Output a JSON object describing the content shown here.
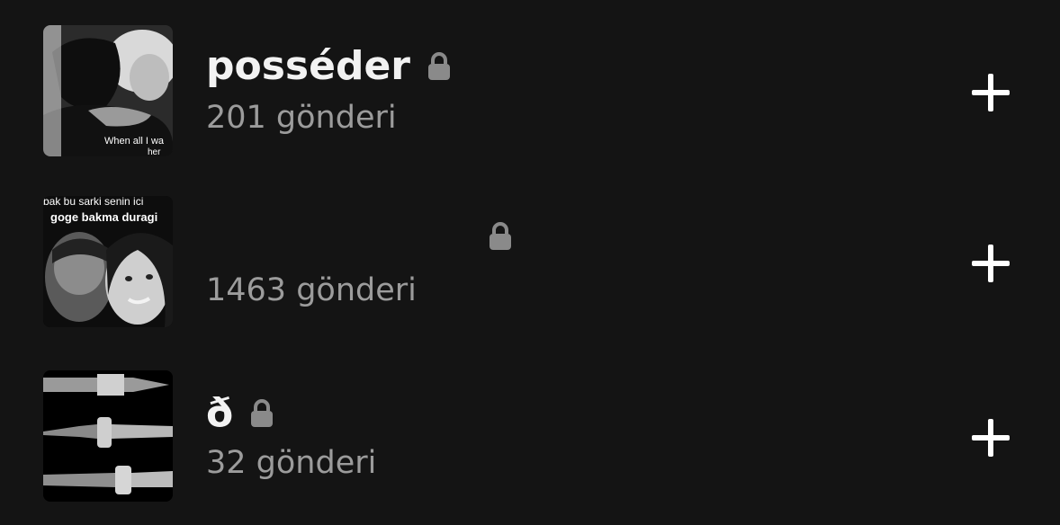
{
  "colors": {
    "background": "#141414",
    "title": "#f2f2f2",
    "count": "#9c9c9c",
    "lock": "#8a8a8a",
    "add": "#ffffff"
  },
  "collections": [
    {
      "title": "posséder",
      "count_label": "201 gönderi",
      "locked": true,
      "thumbnail_caption": "When all I wa",
      "thumbnail_caption_2": "her"
    },
    {
      "title": "",
      "count_label": "1463 gönderi",
      "locked": true,
      "thumbnail_caption": "bak bu sarki senin ici",
      "thumbnail_caption_2": "goge bakma duragi"
    },
    {
      "title": "ð",
      "count_label": "32 gönderi",
      "locked": true
    }
  ],
  "icons": {
    "lock": "lock-icon",
    "add": "plus-icon"
  }
}
